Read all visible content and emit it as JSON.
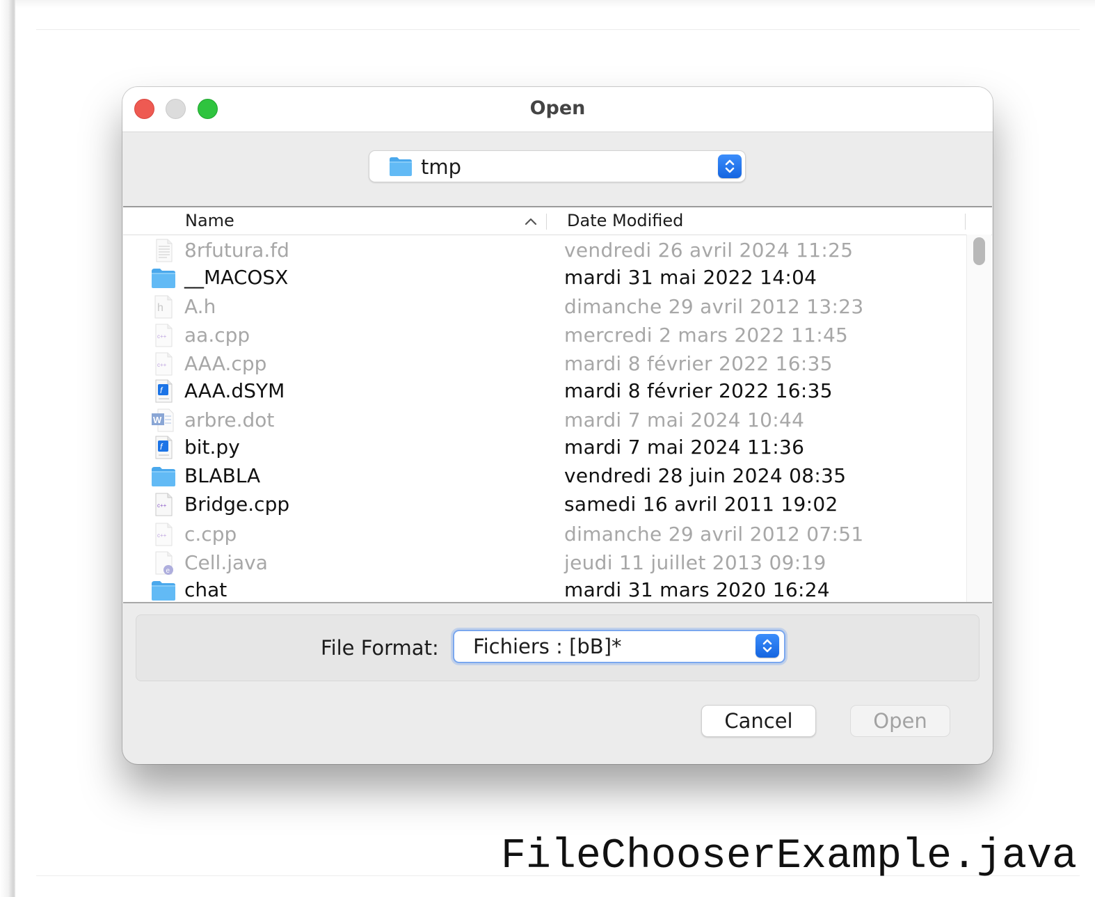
{
  "dialog": {
    "title": "Open",
    "folder_selector": {
      "value": "tmp",
      "icon": "folder-icon"
    }
  },
  "file_table": {
    "columns": {
      "name": "Name",
      "date": "Date Modified"
    },
    "sort": {
      "column": "Name",
      "direction": "ascending"
    },
    "rows": [
      {
        "name": "8rfutura.fd",
        "date": "vendredi 26 avril 2024 11:25",
        "icon": "text-file-icon",
        "enabled": false
      },
      {
        "name": "__MACOSX",
        "date": "mardi 31 mai 2022 14:04",
        "icon": "folder-icon",
        "enabled": true
      },
      {
        "name": "A.h",
        "date": "dimanche 29 avril 2012 13:23",
        "icon": "header-file-icon",
        "enabled": false
      },
      {
        "name": "aa.cpp",
        "date": "mercredi 2 mars 2022 11:45",
        "icon": "cpp-file-icon",
        "enabled": false
      },
      {
        "name": "AAA.cpp",
        "date": "mardi 8 février 2022 16:35",
        "icon": "cpp-file-icon",
        "enabled": false
      },
      {
        "name": "AAA.dSYM",
        "date": "mardi 8 février 2022 16:35",
        "icon": "script-file-icon",
        "enabled": true
      },
      {
        "name": "arbre.dot",
        "date": "mardi 7 mai 2024 10:44",
        "icon": "word-document-icon",
        "enabled": false
      },
      {
        "name": "bit.py",
        "date": "mardi 7 mai 2024 11:36",
        "icon": "script-file-icon",
        "enabled": true
      },
      {
        "name": "BLABLA",
        "date": "vendredi 28 juin 2024 08:35",
        "icon": "folder-icon",
        "enabled": true
      },
      {
        "name": "Bridge.cpp",
        "date": "samedi 16 avril 2011 19:02",
        "icon": "cpp-file-icon",
        "enabled": true
      },
      {
        "name": "c.cpp",
        "date": "dimanche 29 avril 2012 07:51",
        "icon": "cpp-file-icon",
        "enabled": false
      },
      {
        "name": "Cell.java",
        "date": "jeudi 11 juillet 2013 09:19",
        "icon": "java-file-icon",
        "enabled": false
      },
      {
        "name": "chat",
        "date": "mardi 31 mars 2020 16:24",
        "icon": "folder-icon",
        "enabled": true
      }
    ]
  },
  "file_format": {
    "label": "File Format:",
    "value": "Fichiers : [bB]*"
  },
  "buttons": {
    "cancel": "Cancel",
    "open": "Open"
  },
  "caption": "FileChooserExample.java",
  "colors": {
    "accent": "#1a6ef2",
    "close": "#ee5a52",
    "zoom": "#2fc43f",
    "disabled_text": "#a7a7a7"
  }
}
